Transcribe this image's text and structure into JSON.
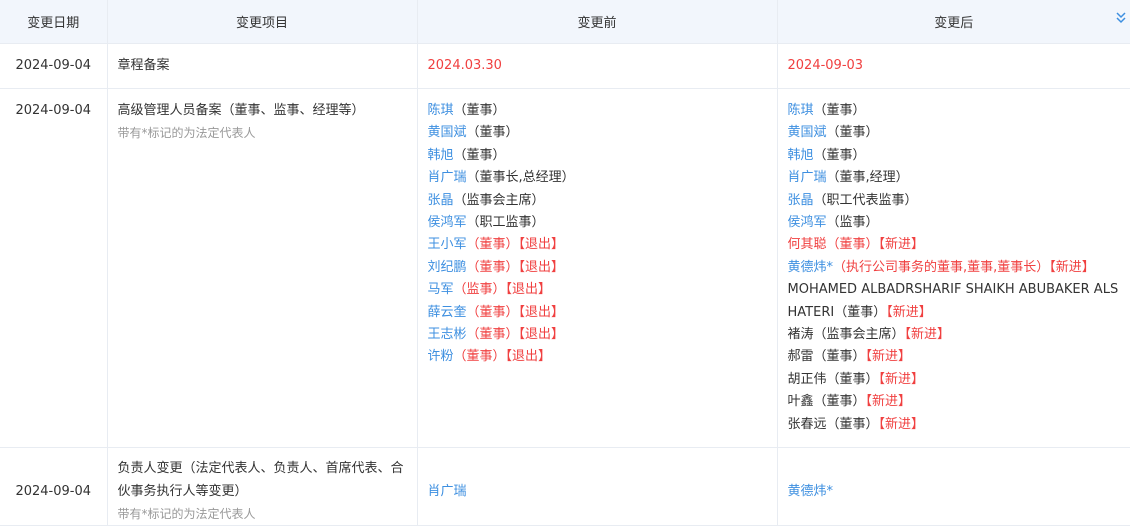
{
  "headers": [
    "变更日期",
    "变更项目",
    "变更前",
    "变更后"
  ],
  "rows": [
    {
      "date": "2024-09-04",
      "item": "章程备案",
      "before": "2024.03.30",
      "after": "2024-09-03"
    },
    {
      "date": "2024-09-04",
      "item": "高级管理人员备案（董事、监事、经理等）",
      "note": "带有*标记的为法定代表人",
      "before": [
        {
          "name": "陈琪",
          "role": "（董事）",
          "tag": ""
        },
        {
          "name": "黄国斌",
          "role": "（董事）",
          "tag": ""
        },
        {
          "name": "韩旭",
          "role": "（董事）",
          "tag": ""
        },
        {
          "name": "肖广瑞",
          "role": "（董事长,总经理）",
          "tag": ""
        },
        {
          "name": "张晶",
          "role": "（监事会主席）",
          "tag": ""
        },
        {
          "name": "侯鸿军",
          "role": "（职工监事）",
          "tag": ""
        },
        {
          "name": "王小军",
          "role": "（董事）",
          "tag": "【退出】"
        },
        {
          "name": "刘纪鹏",
          "role": "（董事）",
          "tag": "【退出】"
        },
        {
          "name": "马军",
          "role": "（监事）",
          "tag": "【退出】"
        },
        {
          "name": "薛云奎",
          "role": "（董事）",
          "tag": "【退出】"
        },
        {
          "name": "王志彬",
          "role": "（董事）",
          "tag": "【退出】"
        },
        {
          "name": "许粉",
          "role": "（董事）",
          "tag": "【退出】"
        }
      ],
      "after": [
        {
          "name": "陈琪",
          "role": "（董事）",
          "tag": ""
        },
        {
          "name": "黄国斌",
          "role": "（董事）",
          "tag": ""
        },
        {
          "name": "韩旭",
          "role": "（董事）",
          "tag": ""
        },
        {
          "name": "肖广瑞",
          "role": "（董事,经理）",
          "tag": ""
        },
        {
          "name": "张晶",
          "role": "（职工代表监事）",
          "tag": ""
        },
        {
          "name": "侯鸿军",
          "role": "（监事）",
          "tag": ""
        },
        {
          "name": "何其聪",
          "role": "（董事）",
          "tag": "【新进】"
        },
        {
          "name": "黄德炜*",
          "role": "（执行公司事务的董事,董事,董事长）",
          "tag": "【新进】"
        },
        {
          "name": "MOHAMED ALBADRSHARIF SHAIKH ABUBAKER ALSHATERI",
          "role": "（董事）",
          "tag": "【新进】"
        },
        {
          "name": "褚涛",
          "role": "（监事会主席）",
          "tag": "【新进】"
        },
        {
          "name": "郝雷",
          "role": "（董事）",
          "tag": "【新进】"
        },
        {
          "name": "胡正伟",
          "role": "（董事）",
          "tag": "【新进】"
        },
        {
          "name": "叶鑫",
          "role": "（董事）",
          "tag": "【新进】"
        },
        {
          "name": "张春远",
          "role": "（董事）",
          "tag": "【新进】"
        }
      ]
    },
    {
      "date": "2024-09-04",
      "item": "负责人变更（法定代表人、负责人、首席代表、合伙事务执行人等变更）",
      "note": "带有*标记的为法定代表人",
      "before": "肖广瑞",
      "after": "黄德炜*"
    }
  ],
  "colors": {
    "link": "#3d8fe0",
    "highlight": "#f04040",
    "header_bg": "#f2f6fc",
    "muted": "#999999"
  },
  "icons": {
    "toggle": "double-chevron-down-icon"
  }
}
